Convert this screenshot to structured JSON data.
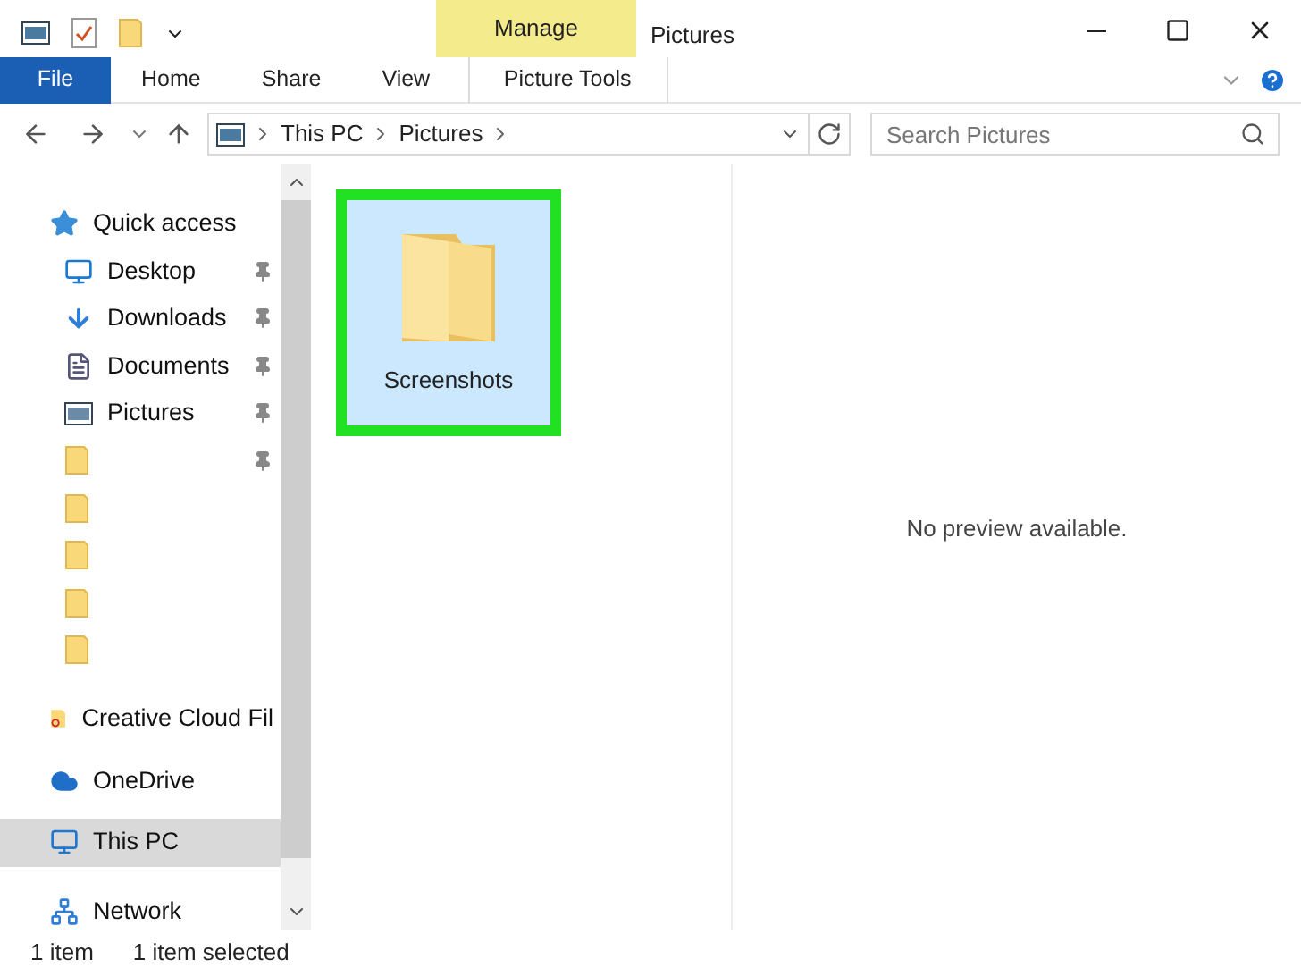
{
  "window": {
    "title": "Pictures"
  },
  "ribbon": {
    "context_group": "Manage",
    "tabs": [
      {
        "label": "File",
        "kind": "file",
        "selected": false
      },
      {
        "label": "Home",
        "kind": "tab",
        "selected": false
      },
      {
        "label": "Share",
        "kind": "tab",
        "selected": false
      },
      {
        "label": "View",
        "kind": "tab",
        "selected": false
      },
      {
        "label": "Picture Tools",
        "kind": "context",
        "selected": false
      }
    ]
  },
  "address": {
    "path": [
      "This PC",
      "Pictures"
    ]
  },
  "search": {
    "placeholder": "Search Pictures"
  },
  "sidebar": {
    "items": [
      {
        "label": "Quick access",
        "kind": "star",
        "selected": false,
        "children": [
          {
            "label": "Desktop",
            "kind": "desktop",
            "pinned": true
          },
          {
            "label": "Downloads",
            "kind": "download",
            "pinned": true
          },
          {
            "label": "Documents",
            "kind": "document",
            "pinned": true
          },
          {
            "label": "Pictures",
            "kind": "picture",
            "pinned": true
          },
          {
            "kind": "folder",
            "pinned": true
          },
          {
            "kind": "folder",
            "pinned": false
          },
          {
            "kind": "folder",
            "pinned": false
          },
          {
            "kind": "folder",
            "pinned": false
          },
          {
            "kind": "folder",
            "pinned": false
          }
        ]
      },
      {
        "label": "Creative Cloud Fil",
        "kind": "cloud-folder",
        "selected": false
      },
      {
        "label": "OneDrive",
        "kind": "cloud",
        "selected": false
      },
      {
        "label": "This PC",
        "kind": "pc",
        "selected": true
      },
      {
        "label": "Network",
        "kind": "network",
        "selected": false
      }
    ]
  },
  "files": [
    {
      "name": "Screenshots",
      "selected": true,
      "highlighted": true
    }
  ],
  "preview": {
    "message": "No preview available."
  },
  "status_bar": {
    "count": "1 item",
    "selection": "1 item selected"
  }
}
